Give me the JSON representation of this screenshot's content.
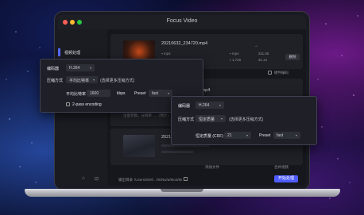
{
  "window": {
    "title": "Focus Video"
  },
  "sidebar": {
    "items": [
      {
        "label": "视频处理"
      }
    ]
  },
  "files": [
    {
      "name": "20210632_234720.mp4",
      "left_meta": [
        "▪ mp4",
        "▪ 1,720"
      ],
      "right_meta": [
        "▪ mp4",
        "▪ 1,720"
      ],
      "right_values": [
        "311.55",
        "31.41"
      ],
      "action_label": "删除"
    },
    {
      "name": "...mp4",
      "left_meta": [],
      "right_meta": []
    },
    {
      "name": "20210...mp4",
      "left_meta": [],
      "right_meta": []
    }
  ],
  "side_checkbox_label": "硬件编码",
  "background_note": "注意参数，分辨率 …（预计）",
  "footer": {
    "output_label": "输出目录",
    "output_path": "/Users/shell…hk/Nw/a/Mo4/Me",
    "add_label": "添加文件",
    "merge_label": "合并视频",
    "start_label": "开始处理"
  },
  "dialog_a": {
    "codec_label": "编码器",
    "codec_value": "H.264",
    "mode_label": "压缩方式",
    "mode_value": "平均比特率",
    "mode_hint": "(选择更多压缩方式)",
    "bitrate_label": "平均比特率",
    "bitrate_value": "1600",
    "bitrate_unit": "kbps",
    "preset_label": "Preset",
    "preset_value": "fast",
    "two_pass_label": "2-pass encoding"
  },
  "dialog_b": {
    "codec_label": "编码器",
    "codec_value": "H.264",
    "mode_label": "压缩方式",
    "mode_value": "恒定质量",
    "mode_hint": "(选择更多压缩方式)",
    "quality_label": "恒定质量 (CRF)",
    "quality_value": "21",
    "preset_label": "Preset",
    "preset_value": "fast"
  },
  "colors": {
    "accent": "#4e5cff",
    "background": "#07081e",
    "window": "#16171c"
  }
}
